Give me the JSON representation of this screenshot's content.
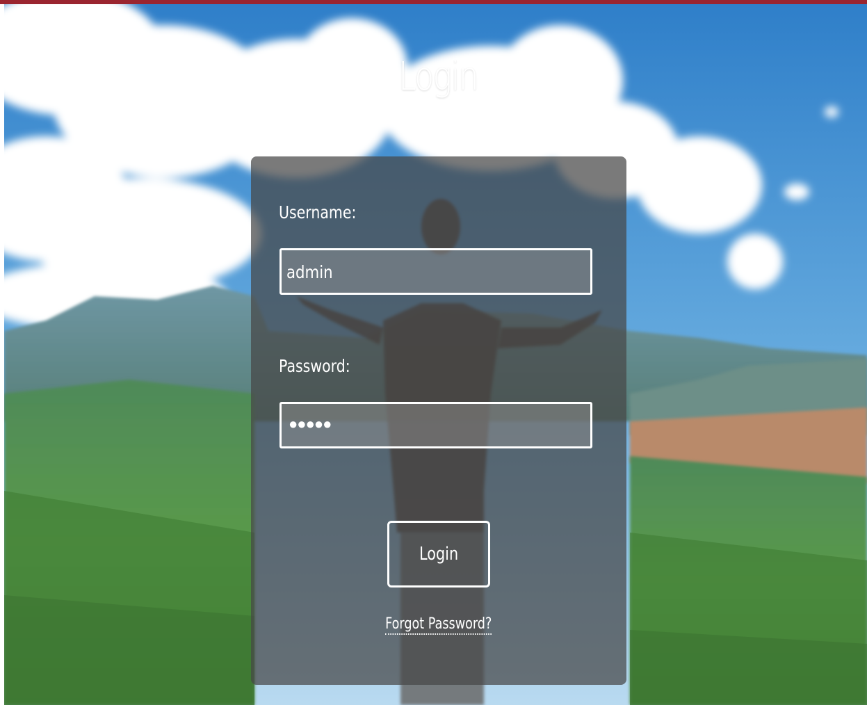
{
  "page": {
    "title": "Login"
  },
  "form": {
    "username_label": "Username:",
    "username_value": "admin",
    "password_label": "Password:",
    "password_mask": "●●●●●",
    "submit_label": "Login",
    "forgot_label": "Forgot Password?"
  },
  "colors": {
    "top_bar": "#9a2530",
    "panel": "rgba(70,70,70,0.72)",
    "text": "#ffffff"
  },
  "icons": {
    "background": "mountain-landscape-photo"
  }
}
